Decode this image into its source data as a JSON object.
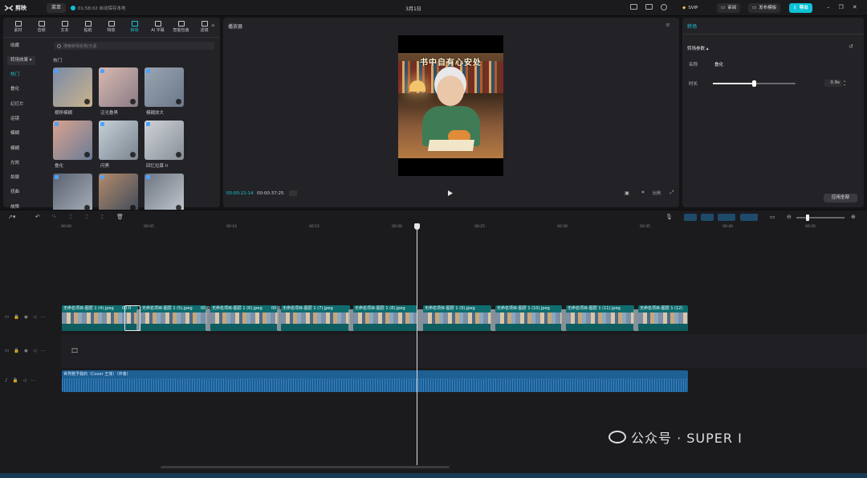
{
  "app": {
    "name": "剪映",
    "menu": "菜单",
    "save_status": "01:58:02 自动保存本地",
    "project_title": "3月1日"
  },
  "titlebar": {
    "vip": "SVIP",
    "review": "审阅",
    "publish": "发布模板",
    "export": "导出"
  },
  "asset_tabs": [
    {
      "label": "素材",
      "icon": "media-icon"
    },
    {
      "label": "音频",
      "icon": "audio-icon"
    },
    {
      "label": "文本",
      "icon": "text-icon"
    },
    {
      "label": "贴纸",
      "icon": "sticker-icon"
    },
    {
      "label": "特效",
      "icon": "effects-icon"
    },
    {
      "label": "转场",
      "icon": "transition-icon",
      "active": true
    },
    {
      "label": "AI 字幕",
      "icon": "subtitle-icon"
    },
    {
      "label": "智能包装",
      "icon": "package-icon"
    },
    {
      "label": "滤镜",
      "icon": "filter-icon"
    }
  ],
  "categories": {
    "favorite": "收藏",
    "group": "转场效果",
    "items": [
      "热门",
      "叠化",
      "幻灯片",
      "运镜",
      "模糊",
      "模糊",
      "光效",
      "拍摄",
      "扭曲",
      "故障"
    ],
    "active_index": 0
  },
  "search": {
    "placeholder": "搜索转场名称/元素"
  },
  "section_title": "热门",
  "transitions": [
    {
      "label": "横移模糊",
      "colors": [
        "#7a8aa6",
        "#c9b38d"
      ]
    },
    {
      "label": "泛光叠黑",
      "colors": [
        "#d8b9b0",
        "#8a7c86"
      ]
    },
    {
      "label": "模糊放大",
      "colors": [
        "#9aa5b3",
        "#6b7888"
      ]
    },
    {
      "label": "叠化",
      "colors": [
        "#d9a28f",
        "#6b7c96"
      ]
    },
    {
      "label": "闪黑",
      "colors": [
        "#c7d0d8",
        "#7a8590"
      ]
    },
    {
      "label": "回忆拉幕 II",
      "colors": [
        "#cfd3d8",
        "#888f98"
      ]
    },
    {
      "label": "",
      "colors": [
        "#5a6270",
        "#a6aeb8"
      ]
    },
    {
      "label": "",
      "colors": [
        "#b38a6a",
        "#3f4b5c"
      ]
    },
    {
      "label": "",
      "colors": [
        "#6d7582",
        "#c2c8cf"
      ]
    }
  ],
  "player": {
    "title": "播放器",
    "poster_title": "书中自有心安处",
    "current_time": "00:00:21:14",
    "total_time": "00:00:37:25",
    "ratio": "比例"
  },
  "inspector": {
    "title": "转场",
    "params": "转场参数",
    "name_label": "名称",
    "name_value": "叠化",
    "duration_label": "时长",
    "duration_value": "0.9s",
    "duration_fraction": 0.5,
    "apply_all": "应用全部"
  },
  "ruler": [
    "00:00",
    "00:05",
    "00:10",
    "00:15",
    "00:20",
    "00:25",
    "00:30",
    "00:35",
    "00:40",
    "00:45"
  ],
  "clips": [
    {
      "name": "无命名项目-图层 1 (4).jpeg"
    },
    {
      "name": "无命名项目-图层 1 (5).jpeg"
    },
    {
      "name": "无命名项目-图层 1 (6).jpeg"
    },
    {
      "name": "无命名项目-图层 1 (7).jpeg"
    },
    {
      "name": "无命名项目-图层 1 (8).jpeg"
    },
    {
      "name": "无命名项目-图层 1 (9).jpeg"
    },
    {
      "name": "无命名项目-图层 1 (10).jpeg"
    },
    {
      "name": "无命名项目-图层 1 (11).jpeg"
    },
    {
      "name": "无命名项目-图层 1 (12)"
    }
  ],
  "clip_labels": [
    "00:0",
    "00:0",
    "00:0"
  ],
  "audio": {
    "name": "世界赠予我的（Cover 王菲）（伴奏）"
  },
  "watermark": "公众号 · SUPER I",
  "colors": {
    "accent": "#0bc1d4",
    "clip": "#0f6d6f",
    "audio": "#1e5f94"
  }
}
